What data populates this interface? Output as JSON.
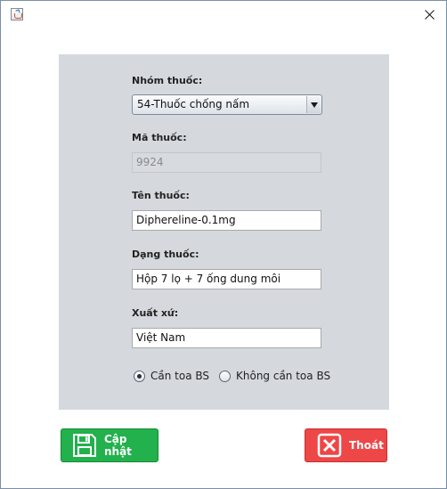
{
  "window": {
    "app_icon": "java-cup-icon",
    "close_icon": "close-icon"
  },
  "form": {
    "group_label": "Nhóm thuốc:",
    "group_value": "54-Thuốc chống nấm",
    "code_label": "Mã thuốc:",
    "code_value": "9924",
    "name_label": "Tên thuốc:",
    "name_value": "Diphereline-0.1mg",
    "form_label": "Dạng thuốc:",
    "form_value": "Hộp 7 lọ + 7 ống dung môi",
    "origin_label": "Xuất xứ:",
    "origin_value": "Việt Nam",
    "radio_prescription": "Cần toa BS",
    "radio_no_prescription": "Không cần toa BS",
    "selected_radio": "Cần toa BS"
  },
  "buttons": {
    "save_label": "Cập nhật",
    "save_icon": "floppy-disk-icon",
    "save_color": "#22b14c",
    "exit_label": "Thoát",
    "exit_icon": "x-box-icon",
    "exit_color": "#ee4748"
  },
  "colors": {
    "panel_bg": "#d5d9de"
  }
}
